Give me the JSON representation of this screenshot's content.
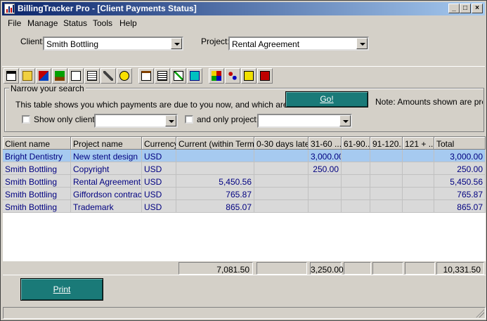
{
  "window": {
    "title": "BillingTracker Pro - [Client Payments Status]",
    "controls": [
      "_",
      "□",
      "×"
    ]
  },
  "menu": [
    {
      "label": "File"
    },
    {
      "label": "Manage"
    },
    {
      "label": "Status"
    },
    {
      "label": "Tools"
    },
    {
      "label": "Help"
    }
  ],
  "filters": {
    "client_label": "Client:",
    "client_value": "Smith Bottling",
    "project_label": "Project:",
    "project_value": "Rental Agreement"
  },
  "toolbar_icons": [
    "calendar-icon",
    "folder-icon",
    "tools-icon",
    "tree-icon",
    "document-icon",
    "ledger-icon",
    "wrench-icon",
    "clock-icon",
    "clipboard-icon",
    "report-icon",
    "checklist-icon",
    "book-icon",
    "chart-icon",
    "network-icon",
    "help-icon",
    "exit-icon"
  ],
  "search": {
    "legend": "Narrow your search",
    "description": "This table shows you which payments are due to you now, and which are late.",
    "go_label": "Go!",
    "note": "Note: Amounts shown are pre-tax",
    "show_only_client_label": "Show only client:",
    "and_only_project_label": "and only project:",
    "client_filter_value": "",
    "project_filter_value": ""
  },
  "table": {
    "columns": [
      "Client name",
      "Project name",
      "Currency",
      "Current (within Terms)",
      "0-30 days late",
      "31-60 ...",
      "61-90...",
      "91-120...",
      "121 + ...",
      "Total"
    ],
    "rows": [
      [
        "Bright Dentistry",
        "New stent design",
        "USD",
        "",
        "",
        "3,000.00",
        "",
        "",
        "",
        "3,000.00"
      ],
      [
        "Smith Bottling",
        "Copyright",
        "USD",
        "",
        "",
        "250.00",
        "",
        "",
        "",
        "250.00"
      ],
      [
        "Smith Bottling",
        "Rental Agreement",
        "USD",
        "5,450.56",
        "",
        "",
        "",
        "",
        "",
        "5,450.56"
      ],
      [
        "Smith Bottling",
        "Giffordson contract",
        "USD",
        "765.87",
        "",
        "",
        "",
        "",
        "",
        "765.87"
      ],
      [
        "Smith Bottling",
        "Trademark",
        "USD",
        "865.07",
        "",
        "",
        "",
        "",
        "",
        "865.07"
      ]
    ],
    "totals": [
      "7,081.50",
      "",
      "3,250.00",
      "",
      "",
      "",
      "10,331.50"
    ]
  },
  "print_label": "Print",
  "colors": {
    "title_start": "#0a246a",
    "title_end": "#a6caf0",
    "selected_row": "#a6caf0",
    "teal_button": "#1a7a78",
    "row_text": "#000080"
  }
}
